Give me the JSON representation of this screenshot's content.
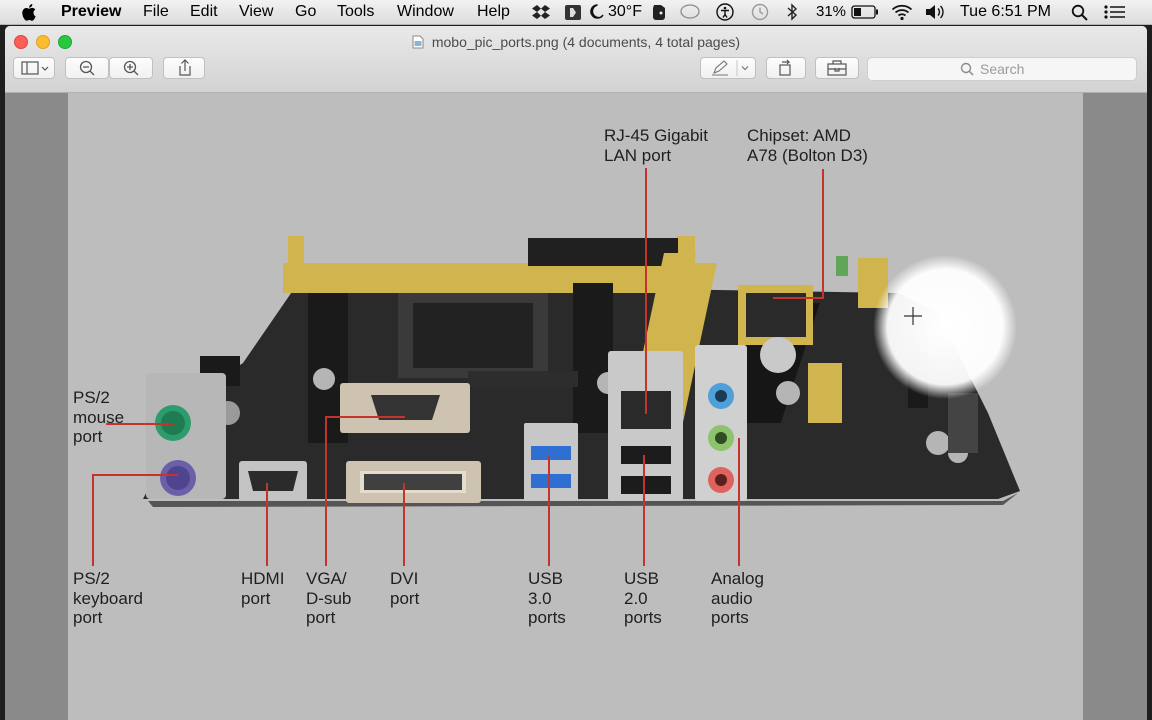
{
  "menubar": {
    "app_name": "Preview",
    "menus": [
      "File",
      "Edit",
      "View",
      "Go",
      "Tools",
      "Window",
      "Help"
    ],
    "weather": "30°F",
    "battery": "31%",
    "clock": "Tue 6:51 PM"
  },
  "window": {
    "title": "mobo_pic_ports.png (4 documents, 4 total pages)",
    "search_placeholder": "Search"
  },
  "image": {
    "labels": {
      "rj45": "RJ-45 Gigabit\nLAN port",
      "chipset": "Chipset: AMD\nA78 (Bolton D3)",
      "ps2_mouse": "PS/2\nmouse\nport",
      "ps2_keyboard": "PS/2\nkeyboard\nport",
      "hdmi": "HDMI\nport",
      "vga": "VGA/\nD-sub\nport",
      "dvi": "DVI\nport",
      "usb3": "USB\n3.0\nports",
      "usb2": "USB\n2.0\nports",
      "audio": "Analog\naudio\nports"
    }
  },
  "colors": {
    "leader_line": "#c4342c",
    "window_background": "#ececec",
    "page_background": "#bdbdbd"
  }
}
